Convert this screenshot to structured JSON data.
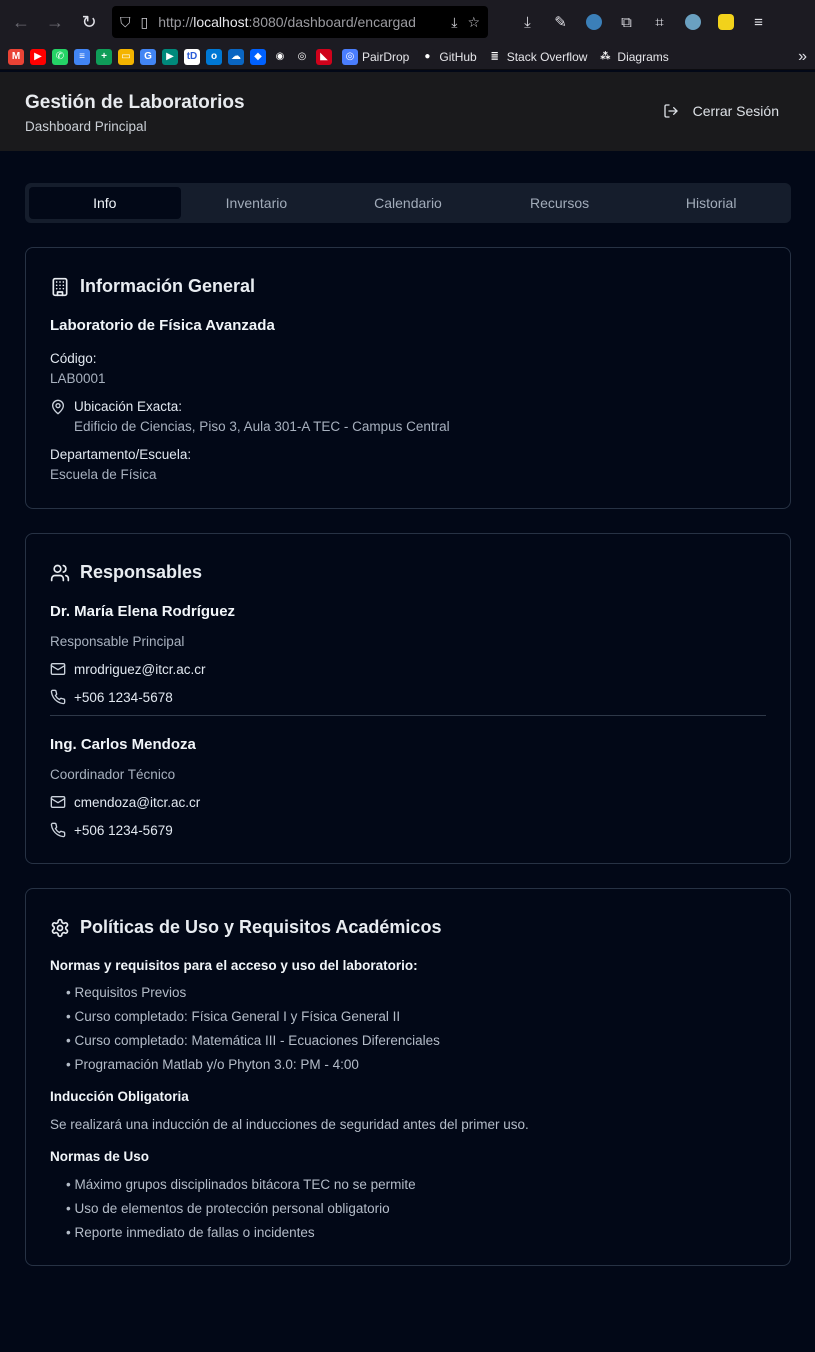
{
  "browser": {
    "url_prefix": "http://",
    "url_host": "localhost",
    "url_rest": ":8080/dashboard/encargad",
    "bookmarks": [
      {
        "icon": "gmail-icon",
        "label": "",
        "color": "#ea4335",
        "glyph": "M"
      },
      {
        "icon": "youtube-icon",
        "label": "",
        "color": "#ff0000",
        "glyph": "▶"
      },
      {
        "icon": "whatsapp-icon",
        "label": "",
        "color": "#25d366",
        "glyph": "✆"
      },
      {
        "icon": "docs-icon",
        "label": "",
        "color": "#4285f4",
        "glyph": "≡"
      },
      {
        "icon": "sheets-icon",
        "label": "",
        "color": "#0f9d58",
        "glyph": "+"
      },
      {
        "icon": "slides-icon",
        "label": "",
        "color": "#f4b400",
        "glyph": "▭"
      },
      {
        "icon": "translate-icon",
        "label": "",
        "color": "#4285f4",
        "glyph": "G"
      },
      {
        "icon": "meet-icon",
        "label": "",
        "color": "#00897b",
        "glyph": "▶"
      },
      {
        "icon": "todoist-icon",
        "label": "",
        "color": "#ffffff",
        "glyph": "tD"
      },
      {
        "icon": "outlook-icon",
        "label": "",
        "color": "#0078d4",
        "glyph": "o"
      },
      {
        "icon": "onedrive-icon",
        "label": "",
        "color": "#0a66c2",
        "glyph": "☁"
      },
      {
        "icon": "dropbox-icon",
        "label": "",
        "color": "#0061ff",
        "glyph": "◆"
      },
      {
        "icon": "github-copilot-icon",
        "label": "",
        "color": "#1c1b22",
        "glyph": "◉"
      },
      {
        "icon": "circle-icon",
        "label": "",
        "color": "#1c1b22",
        "glyph": "◎"
      },
      {
        "icon": "red-logo-icon",
        "label": "",
        "color": "#d0021b",
        "glyph": "◣"
      },
      {
        "icon": "pairdrop-icon",
        "label": "PairDrop",
        "color": "#4a7dfc",
        "glyph": "◎"
      },
      {
        "icon": "github-icon",
        "label": "GitHub",
        "color": "#1c1b22",
        "glyph": "●"
      },
      {
        "icon": "stackoverflow-icon",
        "label": "Stack Overflow",
        "color": "#1c1b22",
        "glyph": "≣"
      },
      {
        "icon": "diagrams-icon",
        "label": "Diagrams",
        "color": "#1c1b22",
        "glyph": "⁂"
      }
    ]
  },
  "header": {
    "title": "Gestión de Laboratorios",
    "subtitle": "Dashboard Principal",
    "logout_label": "Cerrar Sesión"
  },
  "tabs": [
    "Info",
    "Inventario",
    "Calendario",
    "Recursos",
    "Historial"
  ],
  "info": {
    "title": "Información General",
    "lab_name": "Laboratorio de Física Avanzada",
    "code_label": "Código:",
    "code_value": "LAB0001",
    "location_label": "Ubicación Exacta:",
    "location_value": "Edificio de Ciencias, Piso 3, Aula 301-A TEC - Campus Central",
    "dept_label": "Departamento/Escuela:",
    "dept_value": "Escuela de Física"
  },
  "responsables": {
    "title": "Responsables",
    "people": [
      {
        "name": "Dr. María Elena Rodríguez",
        "role": "Responsable Principal",
        "email": "mrodriguez@itcr.ac.cr",
        "phone": "+506 1234-5678"
      },
      {
        "name": "Ing. Carlos Mendoza",
        "role": "Coordinador Técnico",
        "email": "cmendoza@itcr.ac.cr",
        "phone": "+506 1234-5679"
      }
    ]
  },
  "politicas": {
    "title": "Políticas de Uso y Requisitos Académicos",
    "requisitos_heading": "Normas y requisitos para el acceso y uso del laboratorio:",
    "requisitos": [
      "• Requisitos Previos",
      "• Curso completado: Física General I y Física General II",
      "• Curso completado: Matemática III - Ecuaciones Diferenciales",
      "• Programación Matlab y/o Phyton 3.0: PM - 4:00"
    ],
    "induccion_heading": "Inducción Obligatoria",
    "induccion_text": "Se realizará una inducción de al inducciones de seguridad antes del primer uso.",
    "normas_heading": "Normas de Uso",
    "normas": [
      "• Máximo grupos disciplinados bitácora TEC no se permite",
      "• Uso de elementos de protección personal obligatorio",
      "• Reporte inmediato de fallas o incidentes"
    ]
  }
}
